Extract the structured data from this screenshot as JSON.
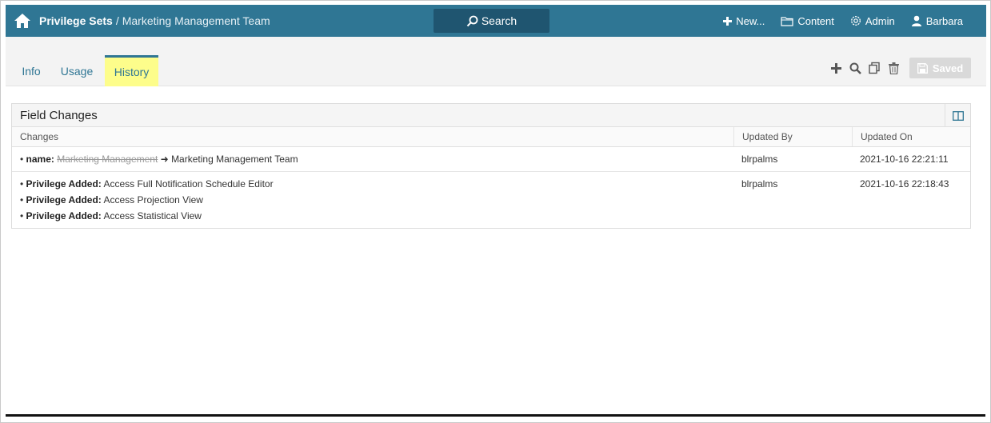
{
  "header": {
    "breadcrumb_link": "Privilege Sets",
    "breadcrumb_sep": "/",
    "breadcrumb_current": "Marketing Management Team",
    "search_label": "Search",
    "nav": {
      "new_label": "New...",
      "content_label": "Content",
      "admin_label": "Admin",
      "user_label": "Barbara"
    },
    "bar_color": "#2f7694"
  },
  "tabs": [
    {
      "label": "Info",
      "active": false
    },
    {
      "label": "Usage",
      "active": false
    },
    {
      "label": "History",
      "active": true
    }
  ],
  "toolbar": {
    "saved_label": "Saved",
    "icons": [
      "plus-icon",
      "search-icon",
      "copy-icon",
      "trash-icon",
      "save-icon"
    ]
  },
  "panel": {
    "title": "Field Changes",
    "columns": [
      "Changes",
      "Updated By",
      "Updated On"
    ],
    "rows": [
      {
        "changes": [
          {
            "field": "name:",
            "old": "Marketing Management",
            "arrow": "➜",
            "new": "Marketing Management Team"
          }
        ],
        "updated_by": "blrpalms",
        "updated_on": "2021-10-16 22:21:11"
      },
      {
        "changes": [
          {
            "field": "Privilege Added:",
            "value": "Access Full Notification Schedule Editor"
          },
          {
            "field": "Privilege Added:",
            "value": "Access Projection View"
          },
          {
            "field": "Privilege Added:",
            "value": "Access Statistical View"
          }
        ],
        "updated_by": "blrpalms",
        "updated_on": "2021-10-16 22:18:43"
      }
    ]
  }
}
